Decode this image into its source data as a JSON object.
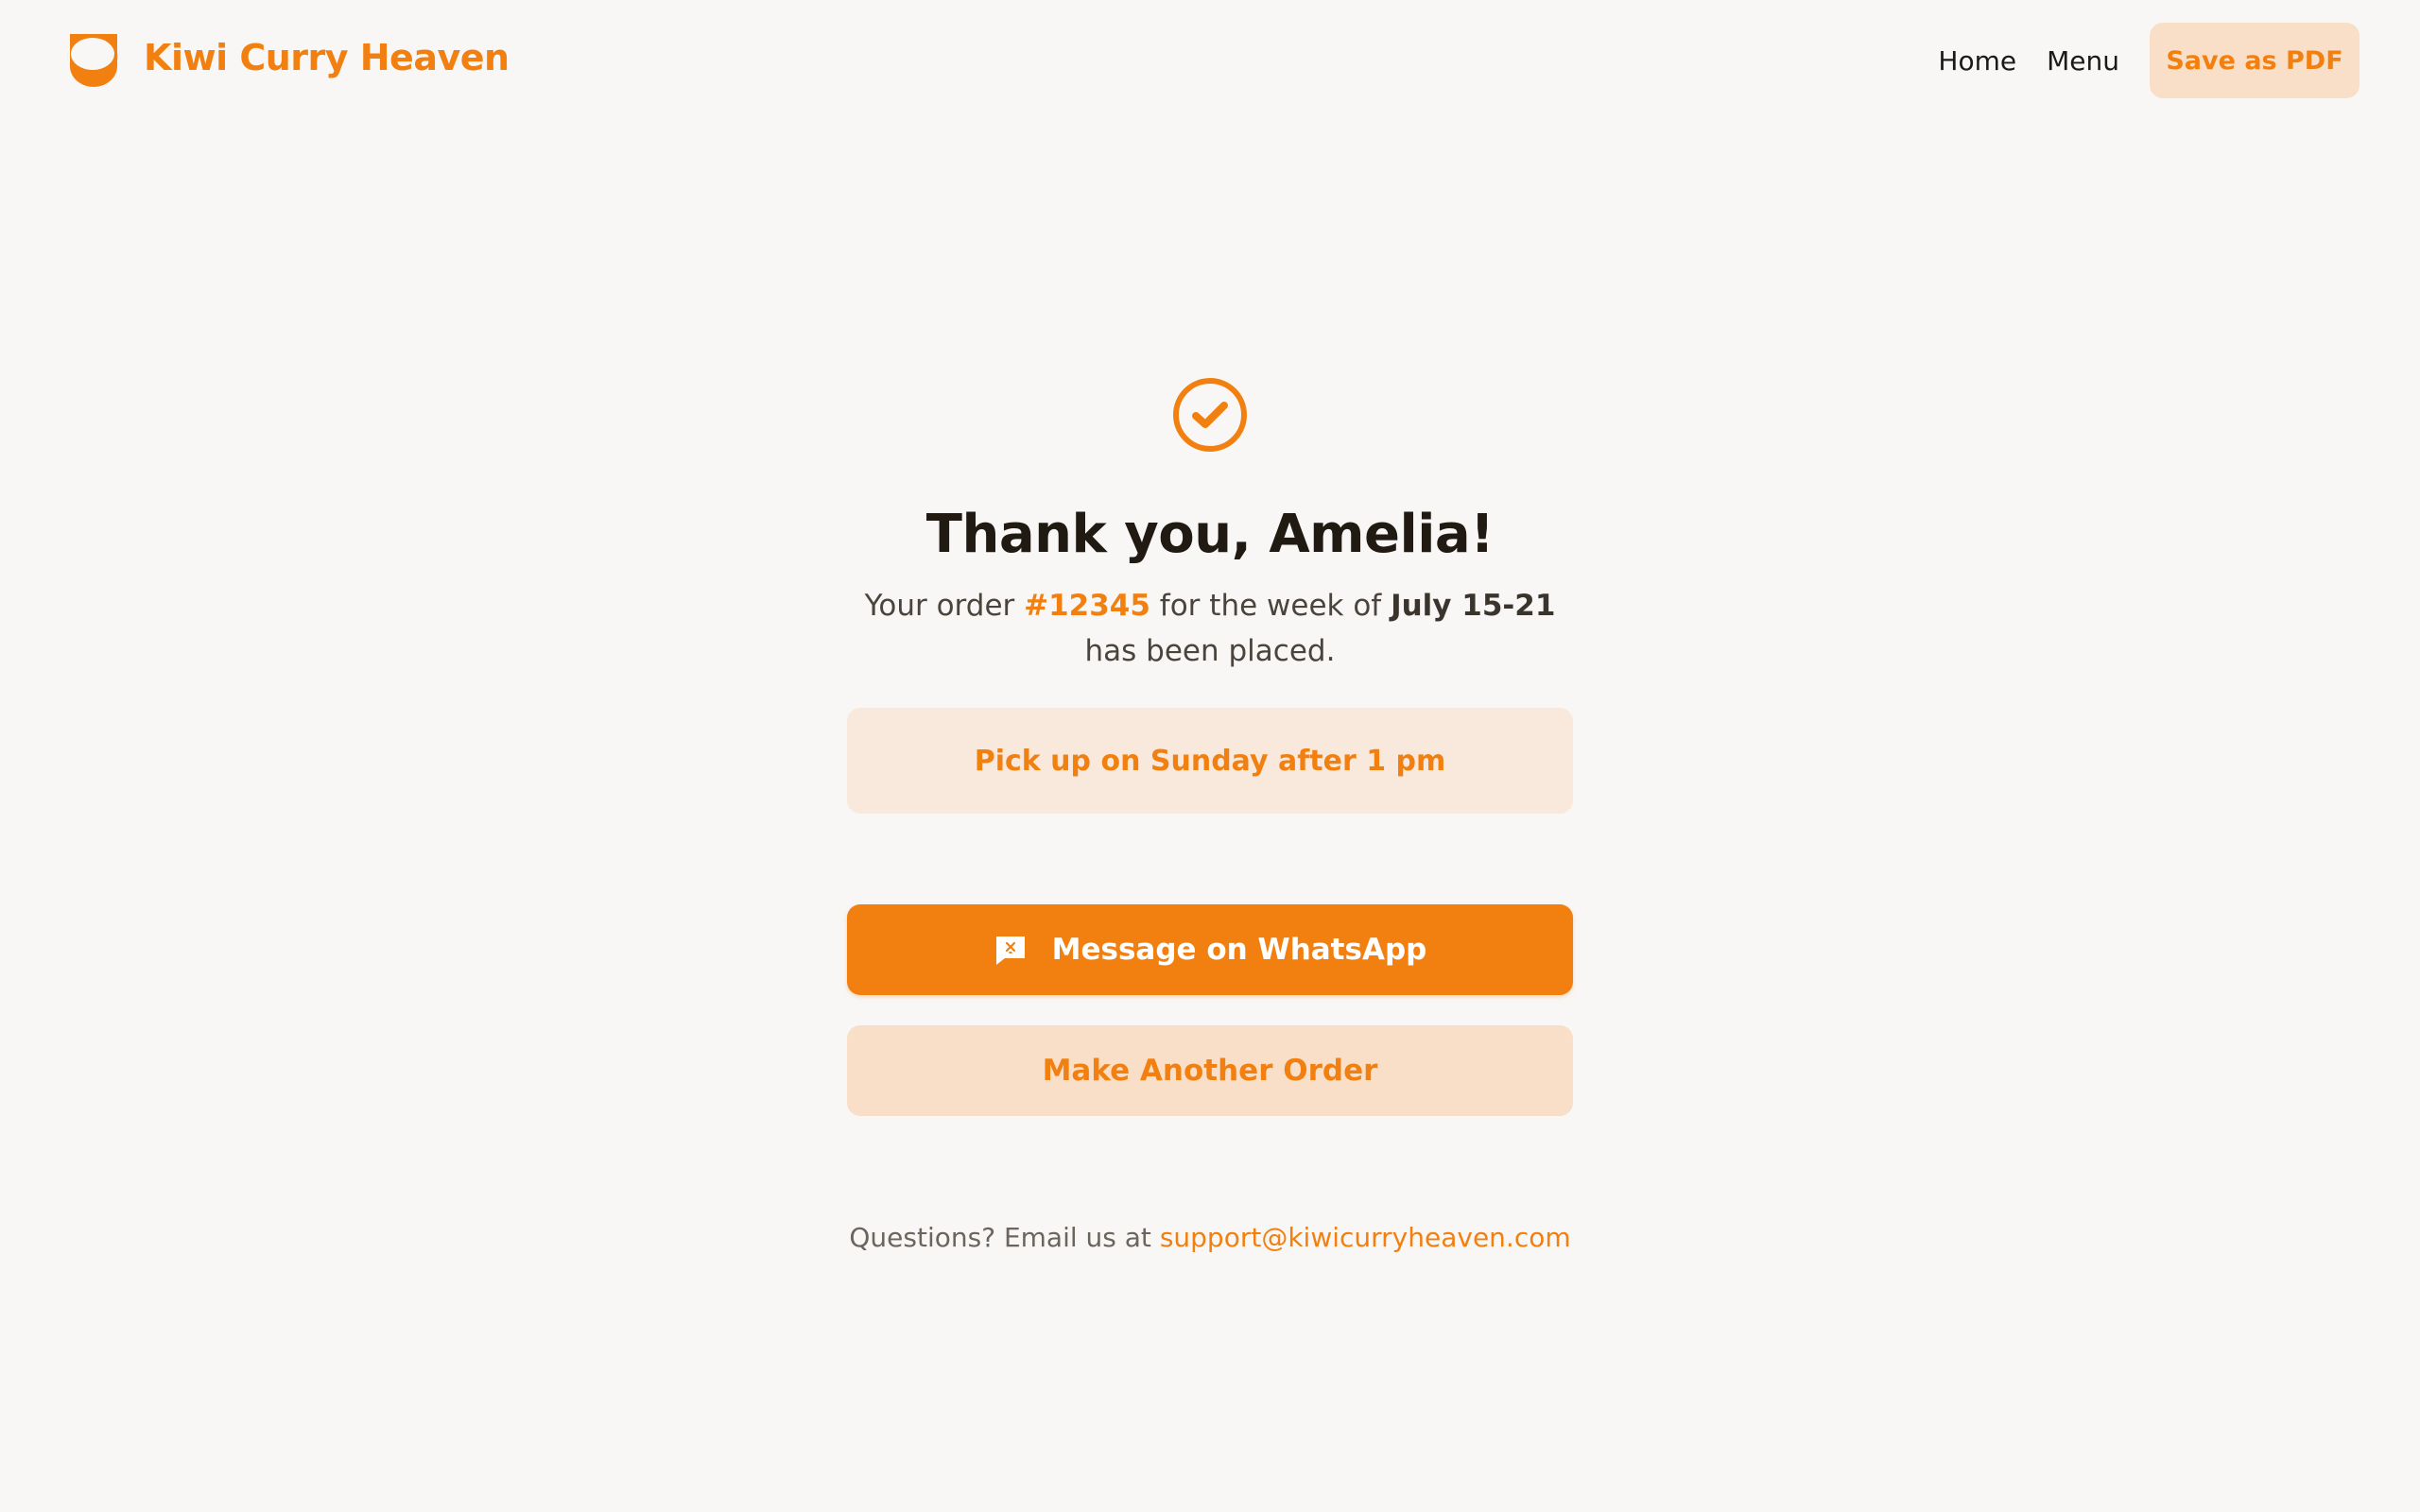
{
  "brand": {
    "name": "Kiwi Curry Heaven",
    "logo_icon": "bowl-logo-icon"
  },
  "nav": {
    "home": "Home",
    "menu": "Menu",
    "save_pdf": "Save as PDF"
  },
  "confirmation": {
    "icon": "check-circle-icon",
    "title": "Thank you, Amelia!",
    "text_before_order": "Your order ",
    "order_number": "#12345",
    "text_before_week": " for the week of ",
    "week": "July 15-21",
    "text_after_week": " has been placed.",
    "pickup": "Pick up on Sunday after 1 pm"
  },
  "actions": {
    "whatsapp_icon": "message-icon",
    "whatsapp_label": "Message on WhatsApp",
    "another_order_label": "Make Another Order"
  },
  "support": {
    "prefix": "Questions? Email us at ",
    "email": "support@kiwicurryheaven.com"
  },
  "colors": {
    "accent": "#f28010",
    "accent_light": "#f9dfc8",
    "pickup_bg": "#f9e9dc",
    "background": "#f8f7f5"
  }
}
